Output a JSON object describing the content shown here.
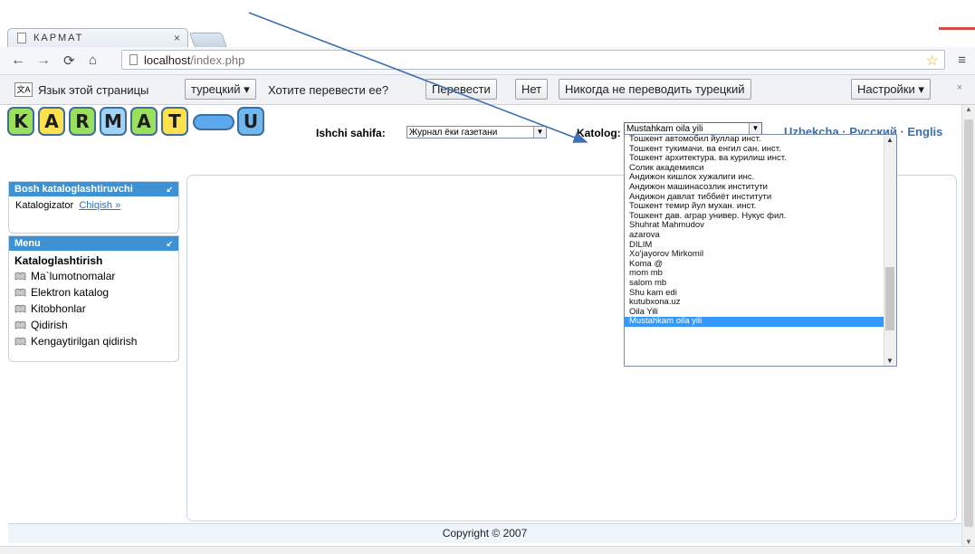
{
  "browser": {
    "tab_title": "КАРМАТ",
    "tab_close": "×",
    "url_host": "localhost",
    "url_path": "/index.php"
  },
  "translate_bar": {
    "prompt": "Язык этой страницы",
    "language": "турецкий",
    "question": "Хотите перевести ее?",
    "translate_btn": "Перевести",
    "no_btn": "Нет",
    "never_btn": "Никогда не переводить турецкий",
    "settings_btn": "Настройки",
    "close": "×"
  },
  "header": {
    "logo_letters": [
      "K",
      "A",
      "R",
      "M",
      "A",
      "T",
      "",
      "U"
    ],
    "logo_colors": [
      "#9be05a",
      "#ffe14d",
      "#9be05a",
      "#9fd2f7",
      "#9be05a",
      "#ffe14d",
      "#5aa9ec",
      "#6fb8f0"
    ],
    "ishchi_label": "Ishchi sahifa:",
    "ishchi_value": "Журнал ёки газетани",
    "katolog_label": "Katolog:",
    "katolog_value": "Mustahkam oila yili",
    "languages": [
      "Uzbekcha",
      "Русский",
      "Englis"
    ]
  },
  "catalog_options": [
    "Тошкент автомобил йуллар инст.",
    "Тошкент тукимачи. ва енгил сан. инст.",
    "Тошкент архитектура. ва курилиш инст.",
    "Солик академияси",
    "Андижон кишлок хужалиги инс.",
    "Андижон машинасозлик институти",
    "Андижон давлат тиббиёт институти",
    "Тошкент темир йул мухан. инст.",
    "Тошкент дав. аграр универ. Нукус фил.",
    "Shuhrat Mahmudov",
    "azarova",
    "DILIM",
    "Xo'jayorov Mirkomil",
    "Koma @",
    "mom mb",
    "salom mb",
    "Shu kam edi",
    "kutubxona.uz",
    "Oila Yili",
    "Mustahkam oila yili"
  ],
  "catalog_selected_index": 19,
  "sidebar": {
    "cataloger_title": "Bosh kataloglashtiruvchi",
    "cataloger_user": "Katalogizator",
    "logout_link": "Chiqish »",
    "menu_title": "Menu",
    "menu_heading": "Kataloglashtirish",
    "menu_items": [
      "Ma`lumotnomalar",
      "Elektron katalog",
      "Kitobhonlar",
      "Qidirish",
      "Kengaytirilgan qidirish"
    ]
  },
  "footer": {
    "copyright": "Copyright © 2007"
  }
}
